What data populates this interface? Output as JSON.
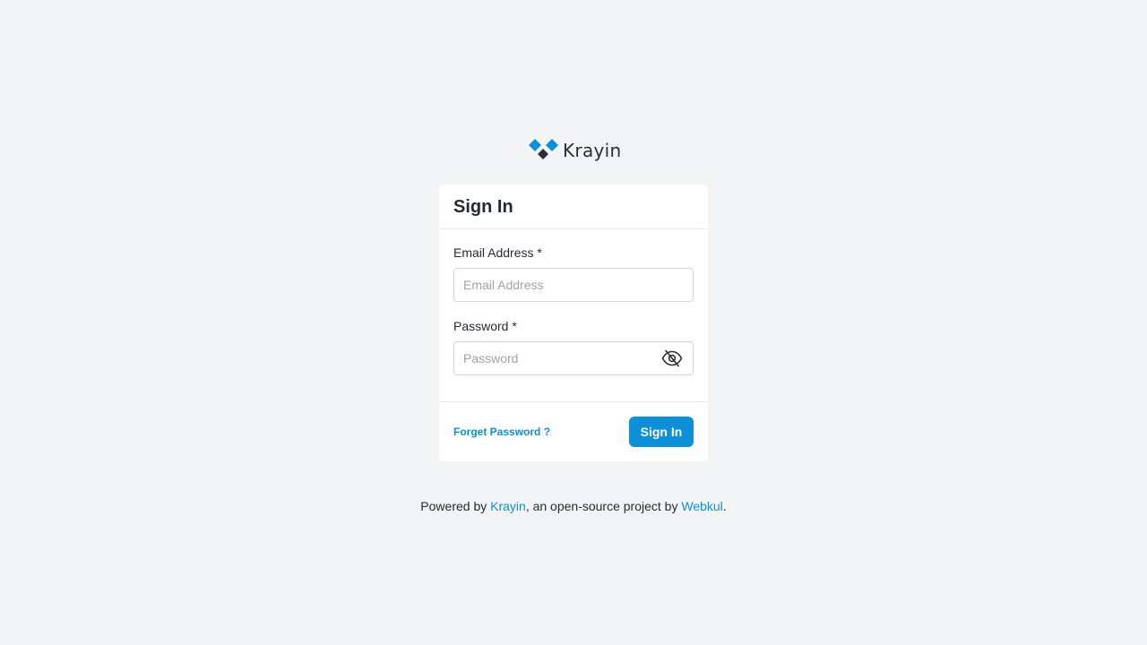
{
  "brand": {
    "logo_text": "Krayin",
    "logo_icon": "krayin-logo-icon",
    "accent_color": "#0e90d9"
  },
  "signin_card": {
    "title": "Sign In",
    "email": {
      "label": "Email Address *",
      "placeholder": "Email Address",
      "value": ""
    },
    "password": {
      "label": "Password *",
      "placeholder": "Password",
      "value": "",
      "toggle_icon": "eye-slash-icon"
    },
    "forgot_label": "Forget Password ?",
    "submit_label": "Sign In"
  },
  "footer": {
    "prefix": "Powered by ",
    "krayin_link": "Krayin",
    "middle": ", an open-source project by ",
    "webkul_link": "Webkul",
    "suffix": "."
  }
}
